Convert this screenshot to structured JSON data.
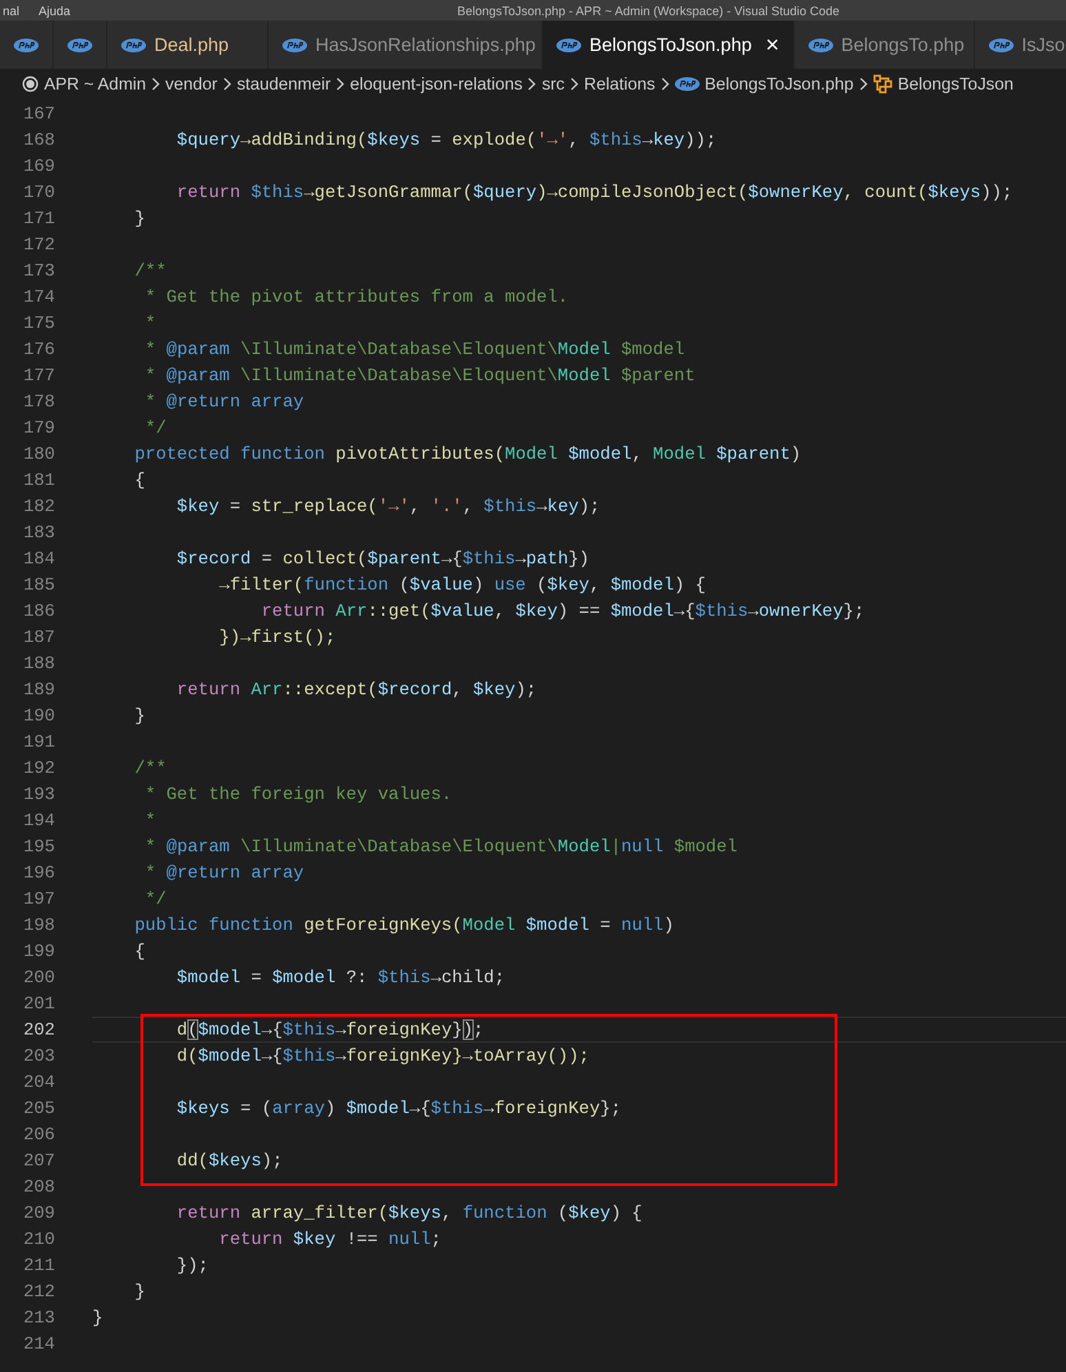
{
  "title_bar": {
    "menu": [
      "nal",
      "Ajuda"
    ],
    "title": "BelongsToJson.php - APR ~ Admin (Workspace) - Visual Studio Code"
  },
  "tabs": [
    {
      "selected": false,
      "modified": false
    },
    {
      "selected": false,
      "modified": false
    },
    {
      "label": "Deal.php",
      "selected": false,
      "modified": true
    },
    {
      "label": "HasJsonRelationships.php",
      "selected": false,
      "modified": false
    },
    {
      "label": "BelongsToJson.php",
      "selected": true,
      "modified": false,
      "close": "×"
    },
    {
      "label": "BelongsTo.php",
      "selected": false,
      "modified": false
    },
    {
      "label": "IsJso",
      "selected": false,
      "modified": false
    }
  ],
  "breadcrumb": [
    {
      "label": "APR ~ Admin",
      "kind": "root"
    },
    {
      "label": "vendor",
      "kind": "folder"
    },
    {
      "label": "staudenmeir",
      "kind": "folder"
    },
    {
      "label": "eloquent-json-relations",
      "kind": "folder"
    },
    {
      "label": "src",
      "kind": "folder"
    },
    {
      "label": "Relations",
      "kind": "folder"
    },
    {
      "label": "BelongsToJson.php",
      "kind": "file"
    },
    {
      "label": "BelongsToJson",
      "kind": "class"
    }
  ],
  "editor": {
    "blocks": [
      {
        "boxed": false,
        "lines": [
          {
            "number": "167",
            "current": false
          },
          {
            "number": "168",
            "current": false,
            "tokens": [
              {
                "text": "        $query",
                "kind": "variable"
              },
              {
                "text": "→addBinding(",
                "kind": "function"
              },
              {
                "text": "$keys",
                "kind": "variable"
              },
              {
                "text": " = ",
                "kind": "plain"
              },
              {
                "text": "explode(",
                "kind": "function"
              },
              {
                "text": "'→'",
                "kind": "string"
              },
              {
                "text": ", ",
                "kind": "plain"
              },
              {
                "text": "$this",
                "kind": "this"
              },
              {
                "text": "→",
                "kind": "plain"
              },
              {
                "text": "key",
                "kind": "variable"
              },
              {
                "text": "));",
                "kind": "plain"
              }
            ]
          },
          {
            "number": "169",
            "current": false
          },
          {
            "number": "170",
            "current": false,
            "tokens": [
              {
                "text": "        return ",
                "kind": "control"
              },
              {
                "text": "$this",
                "kind": "this"
              },
              {
                "text": "→getJsonGrammar(",
                "kind": "function"
              },
              {
                "text": "$query",
                "kind": "variable"
              },
              {
                "text": ")→compileJsonObject(",
                "kind": "function"
              },
              {
                "text": "$ownerKey",
                "kind": "variable"
              },
              {
                "text": ", count(",
                "kind": "function"
              },
              {
                "text": "$keys",
                "kind": "variable"
              },
              {
                "text": "));",
                "kind": "plain"
              }
            ]
          },
          {
            "number": "171",
            "current": false,
            "tokens": [
              {
                "text": "    }",
                "kind": "plain"
              }
            ]
          },
          {
            "number": "172",
            "current": false
          },
          {
            "number": "173",
            "current": false,
            "tokens": [
              {
                "text": "    /**",
                "kind": "comment"
              }
            ]
          },
          {
            "number": "174",
            "current": false,
            "tokens": [
              {
                "text": "     * Get the pivot attributes from a model.",
                "kind": "comment"
              }
            ]
          },
          {
            "number": "175",
            "current": false,
            "tokens": [
              {
                "text": "     *",
                "kind": "comment"
              }
            ]
          },
          {
            "number": "176",
            "current": false,
            "tokens": [
              {
                "text": "     * ",
                "kind": "comment"
              },
              {
                "text": "@param",
                "kind": "keyword"
              },
              {
                "text": " \\Illuminate\\Database\\Eloquent\\",
                "kind": "comment"
              },
              {
                "text": "Model",
                "kind": "type"
              },
              {
                "text": " $model",
                "kind": "comment"
              }
            ]
          },
          {
            "number": "177",
            "current": false,
            "tokens": [
              {
                "text": "     * ",
                "kind": "comment"
              },
              {
                "text": "@param",
                "kind": "keyword"
              },
              {
                "text": " \\Illuminate\\Database\\Eloquent\\",
                "kind": "comment"
              },
              {
                "text": "Model",
                "kind": "type"
              },
              {
                "text": " $parent",
                "kind": "comment"
              }
            ]
          },
          {
            "number": "178",
            "current": false,
            "tokens": [
              {
                "text": "     * ",
                "kind": "comment"
              },
              {
                "text": "@return array",
                "kind": "keyword"
              }
            ]
          },
          {
            "number": "179",
            "current": false,
            "tokens": [
              {
                "text": "     */",
                "kind": "comment"
              }
            ]
          },
          {
            "number": "180",
            "current": false,
            "tokens": [
              {
                "text": "    protected function ",
                "kind": "keyword"
              },
              {
                "text": "pivotAttributes(",
                "kind": "function"
              },
              {
                "text": "Model",
                "kind": "type"
              },
              {
                "text": " $model",
                "kind": "variable"
              },
              {
                "text": ", ",
                "kind": "plain"
              },
              {
                "text": "Model",
                "kind": "type"
              },
              {
                "text": " $parent",
                "kind": "variable"
              },
              {
                "text": ")",
                "kind": "plain"
              }
            ]
          },
          {
            "number": "181",
            "current": false,
            "tokens": [
              {
                "text": "    {",
                "kind": "plain"
              }
            ]
          },
          {
            "number": "182",
            "current": false,
            "tokens": [
              {
                "text": "        $key",
                "kind": "variable"
              },
              {
                "text": " = ",
                "kind": "plain"
              },
              {
                "text": "str_replace(",
                "kind": "function"
              },
              {
                "text": "'→'",
                "kind": "string"
              },
              {
                "text": ", ",
                "kind": "plain"
              },
              {
                "text": "'.'",
                "kind": "string"
              },
              {
                "text": ", ",
                "kind": "plain"
              },
              {
                "text": "$this",
                "kind": "this"
              },
              {
                "text": "→",
                "kind": "plain"
              },
              {
                "text": "key",
                "kind": "variable"
              },
              {
                "text": ");",
                "kind": "plain"
              }
            ]
          },
          {
            "number": "183",
            "current": false
          },
          {
            "number": "184",
            "current": false,
            "tokens": [
              {
                "text": "        $record",
                "kind": "variable"
              },
              {
                "text": " = ",
                "kind": "plain"
              },
              {
                "text": "collect(",
                "kind": "function"
              },
              {
                "text": "$parent",
                "kind": "variable"
              },
              {
                "text": "→{",
                "kind": "plain"
              },
              {
                "text": "$this",
                "kind": "this"
              },
              {
                "text": "→",
                "kind": "plain"
              },
              {
                "text": "path",
                "kind": "variable"
              },
              {
                "text": "})",
                "kind": "plain"
              }
            ]
          },
          {
            "number": "185",
            "current": false,
            "tokens": [
              {
                "text": "            →filter(",
                "kind": "function"
              },
              {
                "text": "function",
                "kind": "keyword"
              },
              {
                "text": " (",
                "kind": "plain"
              },
              {
                "text": "$value",
                "kind": "variable"
              },
              {
                "text": ") ",
                "kind": "plain"
              },
              {
                "text": "use",
                "kind": "keyword"
              },
              {
                "text": " (",
                "kind": "plain"
              },
              {
                "text": "$key",
                "kind": "variable"
              },
              {
                "text": ", ",
                "kind": "plain"
              },
              {
                "text": "$model",
                "kind": "variable"
              },
              {
                "text": ") {",
                "kind": "plain"
              }
            ]
          },
          {
            "number": "186",
            "current": false,
            "tokens": [
              {
                "text": "                return ",
                "kind": "control"
              },
              {
                "text": "Arr",
                "kind": "type"
              },
              {
                "text": "::get(",
                "kind": "function"
              },
              {
                "text": "$value",
                "kind": "variable"
              },
              {
                "text": ", ",
                "kind": "plain"
              },
              {
                "text": "$key",
                "kind": "variable"
              },
              {
                "text": ") == ",
                "kind": "plain"
              },
              {
                "text": "$model",
                "kind": "variable"
              },
              {
                "text": "→{",
                "kind": "plain"
              },
              {
                "text": "$this",
                "kind": "this"
              },
              {
                "text": "→",
                "kind": "plain"
              },
              {
                "text": "ownerKey",
                "kind": "variable"
              },
              {
                "text": "};",
                "kind": "plain"
              }
            ]
          },
          {
            "number": "187",
            "current": false,
            "tokens": [
              {
                "text": "            })→first();",
                "kind": "function"
              }
            ]
          },
          {
            "number": "188",
            "current": false
          },
          {
            "number": "189",
            "current": false,
            "tokens": [
              {
                "text": "        return ",
                "kind": "control"
              },
              {
                "text": "Arr",
                "kind": "type"
              },
              {
                "text": "::except(",
                "kind": "function"
              },
              {
                "text": "$record",
                "kind": "variable"
              },
              {
                "text": ", ",
                "kind": "plain"
              },
              {
                "text": "$key",
                "kind": "variable"
              },
              {
                "text": ");",
                "kind": "plain"
              }
            ]
          },
          {
            "number": "190",
            "current": false,
            "tokens": [
              {
                "text": "    }",
                "kind": "plain"
              }
            ]
          },
          {
            "number": "191",
            "current": false
          },
          {
            "number": "192",
            "current": false,
            "tokens": [
              {
                "text": "    /**",
                "kind": "comment"
              }
            ]
          },
          {
            "number": "193",
            "current": false,
            "tokens": [
              {
                "text": "     * Get the foreign key values.",
                "kind": "comment"
              }
            ]
          },
          {
            "number": "194",
            "current": false,
            "tokens": [
              {
                "text": "     *",
                "kind": "comment"
              }
            ]
          },
          {
            "number": "195",
            "current": false,
            "tokens": [
              {
                "text": "     * ",
                "kind": "comment"
              },
              {
                "text": "@param",
                "kind": "keyword"
              },
              {
                "text": " \\Illuminate\\Database\\Eloquent\\",
                "kind": "comment"
              },
              {
                "text": "Model",
                "kind": "type"
              },
              {
                "text": "|",
                "kind": "comment"
              },
              {
                "text": "null",
                "kind": "keyword"
              },
              {
                "text": " $model",
                "kind": "comment"
              }
            ]
          },
          {
            "number": "196",
            "current": false,
            "tokens": [
              {
                "text": "     * ",
                "kind": "comment"
              },
              {
                "text": "@return array",
                "kind": "keyword"
              }
            ]
          },
          {
            "number": "197",
            "current": false,
            "tokens": [
              {
                "text": "     */",
                "kind": "comment"
              }
            ]
          },
          {
            "number": "198",
            "current": false,
            "tokens": [
              {
                "text": "    public function ",
                "kind": "keyword"
              },
              {
                "text": "getForeignKeys(",
                "kind": "function"
              },
              {
                "text": "Model",
                "kind": "type"
              },
              {
                "text": " $model",
                "kind": "variable"
              },
              {
                "text": " = ",
                "kind": "plain"
              },
              {
                "text": "null",
                "kind": "keyword"
              },
              {
                "text": ")",
                "kind": "plain"
              }
            ]
          },
          {
            "number": "199",
            "current": false,
            "tokens": [
              {
                "text": "    {",
                "kind": "plain"
              }
            ]
          },
          {
            "number": "200",
            "current": false,
            "tokens": [
              {
                "text": "        $model",
                "kind": "variable"
              },
              {
                "text": " = ",
                "kind": "plain"
              },
              {
                "text": "$model",
                "kind": "variable"
              },
              {
                "text": " ?: ",
                "kind": "plain"
              },
              {
                "text": "$this",
                "kind": "this"
              },
              {
                "text": "→child;",
                "kind": "plain"
              }
            ]
          },
          {
            "number": "201",
            "current": false
          }
        ]
      },
      {
        "boxed": true,
        "lines": [
          {
            "number": "202",
            "current": true,
            "tokens": [
              {
                "text": "        d",
                "kind": "function"
              },
              {
                "text": "(",
                "kind": "bracket"
              },
              {
                "text": "$model",
                "kind": "variable"
              },
              {
                "text": "→{",
                "kind": "plain"
              },
              {
                "text": "$this",
                "kind": "this"
              },
              {
                "text": "→",
                "kind": "plain"
              },
              {
                "text": "foreignKey",
                "kind": "function"
              },
              {
                "text": "}",
                "kind": "plain"
              },
              {
                "text": ")",
                "kind": "bracket"
              },
              {
                "text": ";",
                "kind": "plain"
              }
            ]
          },
          {
            "number": "203",
            "current": false,
            "tokens": [
              {
                "text": "        d(",
                "kind": "function"
              },
              {
                "text": "$model",
                "kind": "variable"
              },
              {
                "text": "→{",
                "kind": "plain"
              },
              {
                "text": "$this",
                "kind": "this"
              },
              {
                "text": "→",
                "kind": "plain"
              },
              {
                "text": "foreignKey",
                "kind": "function"
              },
              {
                "text": "}→toArray());",
                "kind": "function"
              }
            ]
          },
          {
            "number": "204",
            "current": false
          },
          {
            "number": "205",
            "current": false,
            "tokens": [
              {
                "text": "        $keys",
                "kind": "variable"
              },
              {
                "text": " = (",
                "kind": "plain"
              },
              {
                "text": "array",
                "kind": "keyword"
              },
              {
                "text": ") ",
                "kind": "plain"
              },
              {
                "text": "$model",
                "kind": "variable"
              },
              {
                "text": "→{",
                "kind": "plain"
              },
              {
                "text": "$this",
                "kind": "this"
              },
              {
                "text": "→",
                "kind": "plain"
              },
              {
                "text": "foreignKey",
                "kind": "function"
              },
              {
                "text": "};",
                "kind": "plain"
              }
            ]
          },
          {
            "number": "206",
            "current": false
          },
          {
            "number": "207",
            "current": false,
            "tokens": [
              {
                "text": "        dd(",
                "kind": "function"
              },
              {
                "text": "$keys",
                "kind": "variable"
              },
              {
                "text": ");",
                "kind": "plain"
              }
            ]
          }
        ]
      },
      {
        "boxed": false,
        "lines": [
          {
            "number": "208",
            "current": false
          },
          {
            "number": "209",
            "current": false,
            "tokens": [
              {
                "text": "        return ",
                "kind": "control"
              },
              {
                "text": "array_filter(",
                "kind": "function"
              },
              {
                "text": "$keys",
                "kind": "variable"
              },
              {
                "text": ", ",
                "kind": "plain"
              },
              {
                "text": "function",
                "kind": "keyword"
              },
              {
                "text": " (",
                "kind": "plain"
              },
              {
                "text": "$key",
                "kind": "variable"
              },
              {
                "text": ") {",
                "kind": "plain"
              }
            ]
          },
          {
            "number": "210",
            "current": false,
            "tokens": [
              {
                "text": "            return ",
                "kind": "control"
              },
              {
                "text": "$key",
                "kind": "variable"
              },
              {
                "text": " !== ",
                "kind": "plain"
              },
              {
                "text": "null",
                "kind": "keyword"
              },
              {
                "text": ";",
                "kind": "plain"
              }
            ]
          },
          {
            "number": "211",
            "current": false,
            "tokens": [
              {
                "text": "        });",
                "kind": "plain"
              }
            ]
          },
          {
            "number": "212",
            "current": false,
            "tokens": [
              {
                "text": "    }",
                "kind": "plain"
              }
            ]
          },
          {
            "number": "213",
            "current": false,
            "tokens": [
              {
                "text": "}",
                "kind": "plain"
              }
            ]
          },
          {
            "number": "214",
            "current": false
          }
        ]
      }
    ]
  }
}
